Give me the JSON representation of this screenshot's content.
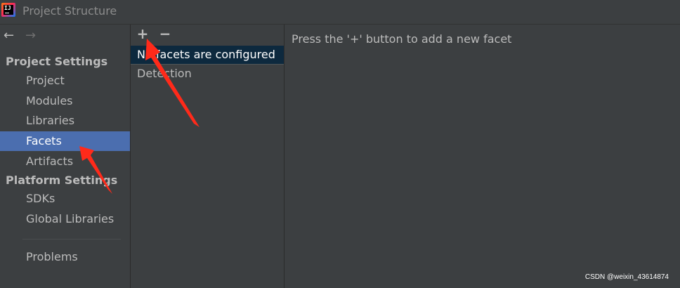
{
  "window": {
    "title": "Project Structure"
  },
  "nav": {
    "back_glyph": "←",
    "forward_glyph": "→"
  },
  "sidebar": {
    "project_settings_header": "Project Settings",
    "project_settings_items": [
      {
        "label": "Project"
      },
      {
        "label": "Modules"
      },
      {
        "label": "Libraries"
      },
      {
        "label": "Facets",
        "selected": true
      },
      {
        "label": "Artifacts"
      }
    ],
    "platform_settings_header": "Platform Settings",
    "platform_settings_items": [
      {
        "label": "SDKs"
      },
      {
        "label": "Global Libraries"
      }
    ],
    "problems_label": "Problems"
  },
  "facets_panel": {
    "add_glyph": "+",
    "remove_glyph": "−",
    "rows": [
      {
        "label": "No facets are configured",
        "selected": true
      },
      {
        "label": "Detection"
      }
    ]
  },
  "content": {
    "hint": "Press the '+' button to add a new facet"
  },
  "watermark": "CSDN @weixin_43614874",
  "colors": {
    "background": "#3c3f41",
    "selection": "#4b6eaf",
    "list_selection": "#0d293e",
    "annotation_arrow": "#ff2a1a"
  }
}
